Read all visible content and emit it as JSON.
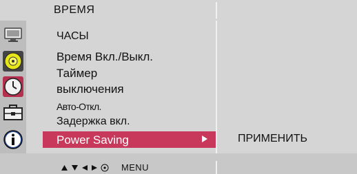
{
  "header": {
    "title": "ВРЕМЯ"
  },
  "icons": [
    {
      "name": "picture-icon",
      "selected": false
    },
    {
      "name": "sound-icon",
      "selected": false
    },
    {
      "name": "clock-icon",
      "selected": true
    },
    {
      "name": "toolbox-icon",
      "selected": false
    },
    {
      "name": "info-icon",
      "selected": false
    }
  ],
  "menu": {
    "items": [
      {
        "label": "ЧАСЫ"
      },
      {
        "label": "Время Вкл./Выкл."
      },
      {
        "label": "Таймер"
      },
      {
        "label": "выключения"
      },
      {
        "label": "Авто-Откл."
      },
      {
        "label": "Задержка вкл."
      }
    ],
    "selected_label": "Power Saving"
  },
  "submenu": {
    "apply_label": "ПРИМЕНИТЬ"
  },
  "footer": {
    "menu_label": "MENU"
  },
  "colors": {
    "highlight": "#c8385b",
    "panel": "#d5d5d5",
    "icon_column": "#bdbdbd"
  }
}
